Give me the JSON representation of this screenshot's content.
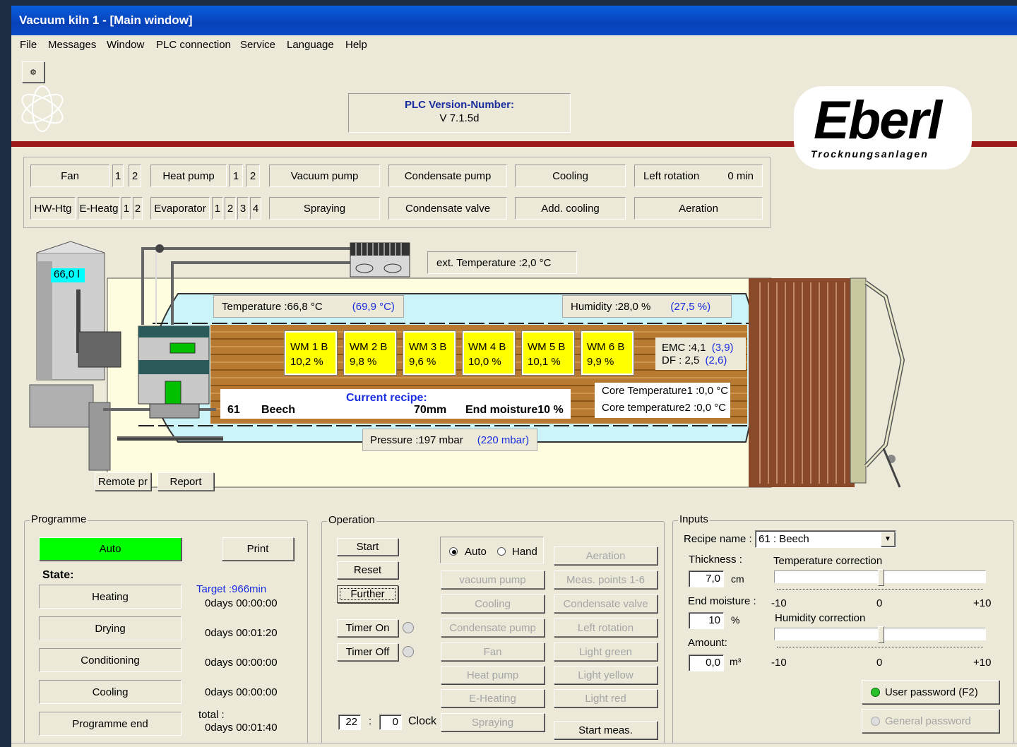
{
  "window": {
    "title": "Vacuum kiln 1 - [Main window]"
  },
  "menu": [
    "File",
    "Messages",
    "Window",
    "PLC connection",
    "Service",
    "Language",
    "Help"
  ],
  "plc": {
    "label": "PLC Version-Number:",
    "value": "V 7.1.5d"
  },
  "logo": {
    "name": "Eberl",
    "sub": "Trocknungsanlagen",
    "accent": "#b01515"
  },
  "status_row1": {
    "fan": "Fan",
    "fan_1": "1",
    "fan_2": "2",
    "heat_pump": "Heat pump",
    "hp_1": "1",
    "hp_2": "2",
    "vacuum_pump": "Vacuum pump",
    "condensate_pump": "Condensate pump",
    "cooling": "Cooling",
    "left_rotation": "Left rotation",
    "left_rotation_value": "0 min"
  },
  "status_row2": {
    "hw_htg": "HW-Htg",
    "e_heatg": "E-Heatg",
    "eh_1": "1",
    "eh_2": "2",
    "evaporator": "Evaporator",
    "ev_1": "1",
    "ev_2": "2",
    "ev_3": "3",
    "ev_4": "4",
    "spraying": "Spraying",
    "condensate_valve": "Condensate valve",
    "add_cooling": "Add. cooling",
    "aeration": "Aeration"
  },
  "kiln": {
    "tank_level": "66,0 l",
    "ext_temperature": "ext. Temperature :2,0  °C",
    "temperature": "Temperature :66,8 °C",
    "temperature_set": "(69,9  °C)",
    "humidity": "Humidity   :28,0  %",
    "humidity_set": "(27,5  %)",
    "wm": [
      {
        "name": "WM 1 B",
        "value": "10,2  %"
      },
      {
        "name": "WM 2 B",
        "value": "9,8  %"
      },
      {
        "name": "WM 3 B",
        "value": "9,6  %"
      },
      {
        "name": "WM 4 B",
        "value": "10,0  %"
      },
      {
        "name": "WM 5 B",
        "value": "10,1  %"
      },
      {
        "name": "WM 6 B",
        "value": "9,9  %"
      }
    ],
    "emc": "EMC :4,1",
    "emc_set": "(3,9)",
    "df": "DF :   2,5",
    "df_set": "(2,6)",
    "recipe_title": "Current recipe:",
    "recipe_no": "61",
    "recipe_wood": "Beech",
    "recipe_thickness": "70mm",
    "recipe_end": "End moisture10 %",
    "core1": "Core Temperature1 :0,0  °C",
    "core2": "Core temperature2 :0,0  °C",
    "pressure": "Pressure :197  mbar",
    "pressure_set": "(220 mbar)"
  },
  "under_kiln": {
    "remote": "Remote pr",
    "report": "Report"
  },
  "programme": {
    "title": "Programme",
    "auto": "Auto",
    "print": "Print",
    "state_label": "State:",
    "target": "Target :966min",
    "steps": [
      {
        "name": "Heating",
        "time": "0days 00:00:00"
      },
      {
        "name": "Drying",
        "time": "0days 00:01:20"
      },
      {
        "name": "Conditioning",
        "time": "0days 00:00:00"
      },
      {
        "name": "Cooling",
        "time": "0days 00:00:00"
      },
      {
        "name": "Programme end",
        "time": "0days 00:01:40"
      }
    ],
    "total_label": "total :"
  },
  "operation": {
    "title": "Operation",
    "start": "Start",
    "reset": "Reset",
    "further": "Further",
    "timer_on": "Timer On",
    "timer_off": "Timer Off",
    "auto": "Auto",
    "hand": "Hand",
    "hour": "22",
    "minute": "0",
    "clock": "Clock",
    "colon": ":",
    "col1": [
      "vacuum pump",
      "Cooling",
      "Condensate pump",
      "Fan",
      "Heat pump",
      "E-Heating",
      "Spraying"
    ],
    "col2": [
      "Aeration",
      "Meas. points 1-6",
      "Condensate valve",
      "Left rotation",
      "Light green",
      "Light yellow",
      "Light red"
    ],
    "start_meas": "Start meas."
  },
  "inputs": {
    "title": "Inputs",
    "recipe_label": "Recipe name :",
    "recipe_value": "61 : Beech",
    "thickness_label": "Thickness :",
    "thickness_value": "7,0",
    "thickness_unit": "cm",
    "end_moisture_label": "End moisture :",
    "end_moisture_value": "10",
    "end_moisture_unit": "%",
    "amount_label": "Amount:",
    "amount_value": "0,0",
    "amount_unit": "m³",
    "temp_corr": "Temperature correction",
    "hum_corr": "Humidity correction",
    "scale_min": "-10",
    "scale_mid": "0",
    "scale_max": "+10",
    "temp_corr_value": 0,
    "hum_corr_value": 0,
    "user_password": "User password (F2)",
    "general_password": "General password"
  }
}
